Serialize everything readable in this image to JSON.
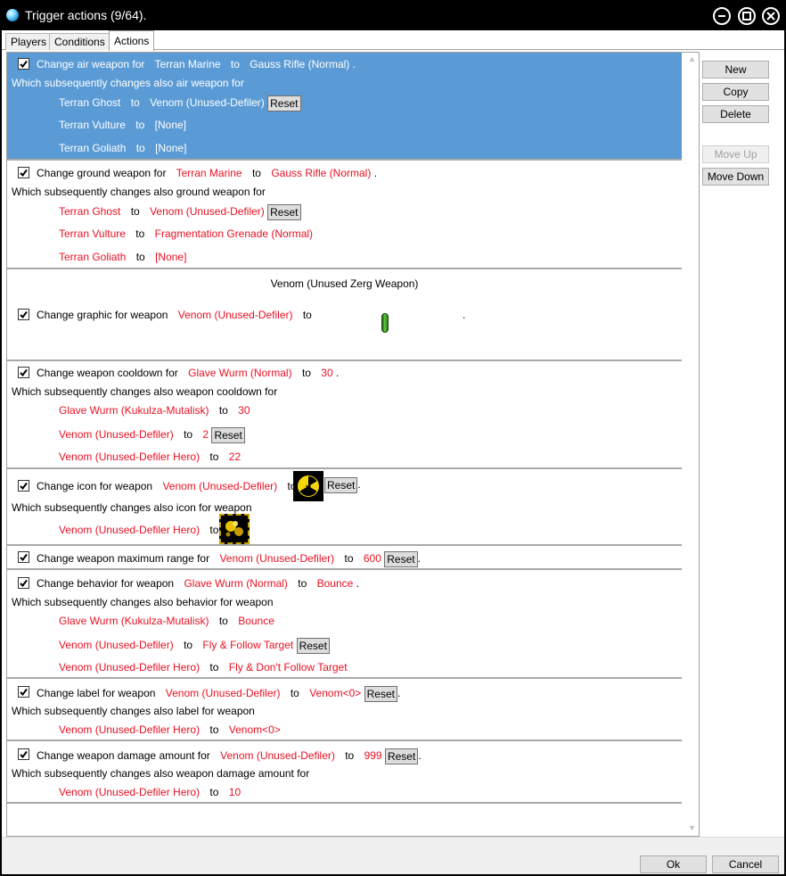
{
  "window": {
    "title": "Trigger actions (9/64)."
  },
  "tabs": [
    "Players",
    "Conditions",
    "Actions"
  ],
  "side_buttons": {
    "new": "New",
    "copy": "Copy",
    "delete": "Delete",
    "move_up": "Move Up",
    "move_down": "Move Down"
  },
  "footer": {
    "ok": "Ok",
    "cancel": "Cancel"
  },
  "common": {
    "to": "to",
    "reset": "Reset",
    "period": "."
  },
  "items": [
    {
      "label": "Change air weapon for",
      "unit": "Terran Marine",
      "value": "Gauss Rifle (Normal)",
      "subsequent": "Which subsequently changes also air weapon for",
      "rows": [
        {
          "unit": "Terran Ghost",
          "value": "Venom (Unused-Defiler)"
        },
        {
          "unit": "Terran Vulture",
          "value": "[None]"
        },
        {
          "unit": "Terran Goliath",
          "value": "[None]"
        }
      ]
    },
    {
      "label": "Change ground weapon for",
      "unit": "Terran Marine",
      "value": "Gauss Rifle (Normal)",
      "subsequent": "Which subsequently changes also ground weapon for",
      "rows": [
        {
          "unit": "Terran Ghost",
          "value": "Venom (Unused-Defiler)"
        },
        {
          "unit": "Terran Vulture",
          "value": "Fragmentation Grenade (Normal)"
        },
        {
          "unit": "Terran Goliath",
          "value": "[None]"
        }
      ]
    },
    {
      "header": "Venom (Unused Zerg Weapon)",
      "label": "Change graphic for weapon",
      "unit": "Venom (Unused-Defiler)"
    },
    {
      "label": "Change weapon cooldown for",
      "unit": "Glave Wurm (Normal)",
      "value": "30",
      "subsequent": "Which subsequently changes also weapon cooldown for",
      "rows": [
        {
          "unit": "Glave Wurm (Kukulza-Mutalisk)",
          "value": "30"
        },
        {
          "unit": "Venom (Unused-Defiler)",
          "value": "2"
        },
        {
          "unit": "Venom (Unused-Defiler Hero)",
          "value": "22"
        }
      ]
    },
    {
      "label": "Change icon for weapon",
      "unit": "Venom (Unused-Defiler)",
      "subsequent": "Which subsequently changes also icon for weapon",
      "rows": [
        {
          "unit": "Venom (Unused-Defiler Hero)"
        }
      ]
    },
    {
      "label": "Change weapon maximum range for",
      "unit": "Venom (Unused-Defiler)",
      "value": "600"
    },
    {
      "label": "Change behavior for weapon",
      "unit": "Glave Wurm (Normal)",
      "value": "Bounce",
      "subsequent": "Which subsequently changes also behavior for weapon",
      "rows": [
        {
          "unit": "Glave Wurm (Kukulza-Mutalisk)",
          "value": "Bounce"
        },
        {
          "unit": "Venom (Unused-Defiler)",
          "value": "Fly & Follow Target"
        },
        {
          "unit": "Venom (Unused-Defiler Hero)",
          "value": "Fly & Don't Follow Target"
        }
      ]
    },
    {
      "label": "Change label for weapon",
      "unit": "Venom (Unused-Defiler)",
      "value": "Venom<0>",
      "subsequent": "Which subsequently changes also label for weapon",
      "rows": [
        {
          "unit": "Venom (Unused-Defiler Hero)",
          "value": "Venom<0>"
        }
      ]
    },
    {
      "label": "Change weapon damage amount for",
      "unit": "Venom (Unused-Defiler)",
      "value": "999",
      "subsequent": "Which subsequently changes also weapon damage amount for",
      "rows": [
        {
          "unit": "Venom (Unused-Defiler Hero)",
          "value": "10"
        }
      ]
    }
  ]
}
